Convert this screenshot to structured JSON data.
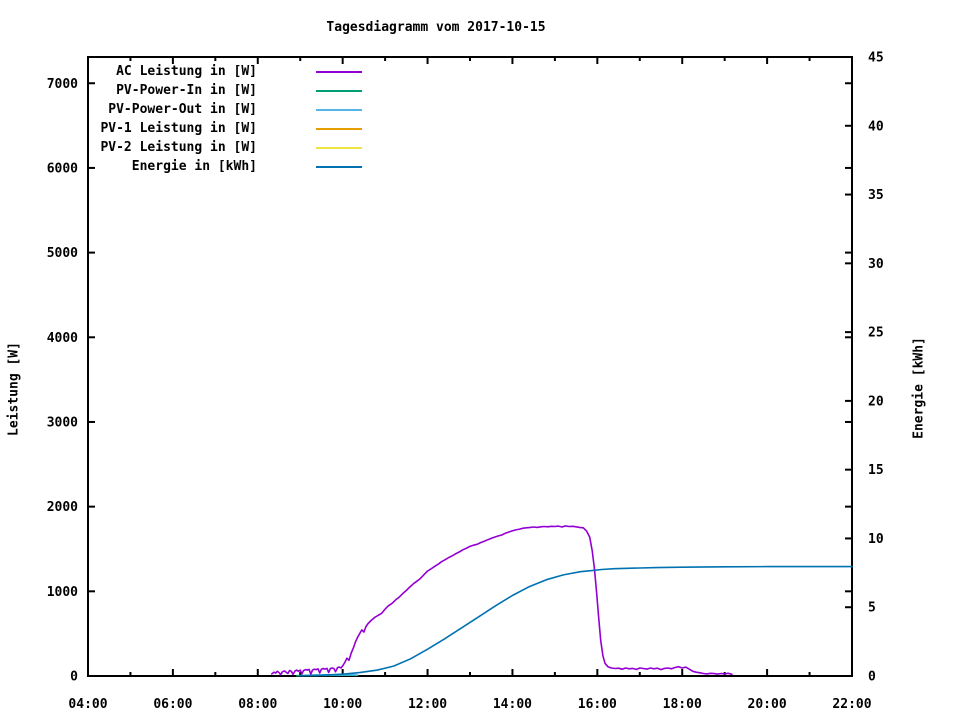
{
  "title": "Tagesdiagramm vom 2017-10-15",
  "axes": {
    "y1_label": "Leistung [W]",
    "y2_label": "Energie [kWh]",
    "y1_ticks": [
      0,
      1000,
      2000,
      3000,
      4000,
      5000,
      6000,
      7000
    ],
    "y2_ticks": [
      0,
      5,
      10,
      15,
      20,
      25,
      30,
      35,
      40,
      45
    ],
    "x_ticks": [
      {
        "h": 4,
        "label": "04:00"
      },
      {
        "h": 6,
        "label": "06:00"
      },
      {
        "h": 8,
        "label": "08:00"
      },
      {
        "h": 10,
        "label": "10:00"
      },
      {
        "h": 12,
        "label": "12:00"
      },
      {
        "h": 14,
        "label": "14:00"
      },
      {
        "h": 16,
        "label": "16:00"
      },
      {
        "h": 18,
        "label": "18:00"
      },
      {
        "h": 20,
        "label": "20:00"
      },
      {
        "h": 22,
        "label": "22:00"
      }
    ],
    "x_minor_ticks": [
      5,
      7,
      9,
      11,
      13,
      15,
      17,
      19,
      21
    ]
  },
  "chart_data": {
    "type": "line",
    "title": "Tagesdiagramm vom 2017-10-15",
    "xlabel": "",
    "ylabel": "Leistung [W]",
    "y2label": "Energie [kWh]",
    "x_unit": "hour-of-day",
    "xlim": [
      4,
      22
    ],
    "ylim": [
      0,
      7310
    ],
    "y2lim": [
      0,
      45
    ],
    "grid": false,
    "legend_position": "top-left-inside",
    "series": [
      {
        "name": "AC Leistung in [W]",
        "color": "#9400d3",
        "axis": "y1",
        "points": [
          [
            8.33,
            25
          ],
          [
            8.38,
            45
          ],
          [
            8.42,
            35
          ],
          [
            8.46,
            55
          ],
          [
            8.5,
            40
          ],
          [
            8.54,
            15
          ],
          [
            8.58,
            50
          ],
          [
            8.63,
            60
          ],
          [
            8.67,
            45
          ],
          [
            8.71,
            30
          ],
          [
            8.75,
            65
          ],
          [
            8.79,
            55
          ],
          [
            8.83,
            20
          ],
          [
            8.88,
            60
          ],
          [
            8.92,
            70
          ],
          [
            8.96,
            55
          ],
          [
            9.0,
            70
          ],
          [
            9.04,
            25
          ],
          [
            9.08,
            65
          ],
          [
            9.13,
            75
          ],
          [
            9.17,
            70
          ],
          [
            9.21,
            78
          ],
          [
            9.25,
            20
          ],
          [
            9.29,
            70
          ],
          [
            9.33,
            80
          ],
          [
            9.38,
            75
          ],
          [
            9.42,
            85
          ],
          [
            9.46,
            35
          ],
          [
            9.5,
            80
          ],
          [
            9.54,
            88
          ],
          [
            9.58,
            82
          ],
          [
            9.63,
            90
          ],
          [
            9.67,
            40
          ],
          [
            9.71,
            88
          ],
          [
            9.75,
            95
          ],
          [
            9.79,
            90
          ],
          [
            9.83,
            50
          ],
          [
            9.88,
            100
          ],
          [
            9.92,
            105
          ],
          [
            9.96,
            95
          ],
          [
            10.0,
            120
          ],
          [
            10.05,
            160
          ],
          [
            10.1,
            210
          ],
          [
            10.15,
            185
          ],
          [
            10.2,
            270
          ],
          [
            10.25,
            330
          ],
          [
            10.3,
            400
          ],
          [
            10.35,
            455
          ],
          [
            10.4,
            500
          ],
          [
            10.45,
            545
          ],
          [
            10.5,
            520
          ],
          [
            10.55,
            585
          ],
          [
            10.6,
            620
          ],
          [
            10.67,
            655
          ],
          [
            10.75,
            690
          ],
          [
            10.83,
            715
          ],
          [
            10.92,
            740
          ],
          [
            11.0,
            790
          ],
          [
            11.08,
            830
          ],
          [
            11.17,
            860
          ],
          [
            11.25,
            900
          ],
          [
            11.33,
            930
          ],
          [
            11.42,
            975
          ],
          [
            11.5,
            1010
          ],
          [
            11.58,
            1050
          ],
          [
            11.67,
            1090
          ],
          [
            11.75,
            1120
          ],
          [
            11.83,
            1150
          ],
          [
            11.92,
            1200
          ],
          [
            12.0,
            1240
          ],
          [
            12.08,
            1265
          ],
          [
            12.17,
            1295
          ],
          [
            12.25,
            1320
          ],
          [
            12.33,
            1350
          ],
          [
            12.42,
            1375
          ],
          [
            12.5,
            1400
          ],
          [
            12.58,
            1420
          ],
          [
            12.67,
            1445
          ],
          [
            12.75,
            1465
          ],
          [
            12.83,
            1490
          ],
          [
            12.92,
            1510
          ],
          [
            13.0,
            1530
          ],
          [
            13.08,
            1545
          ],
          [
            13.17,
            1555
          ],
          [
            13.25,
            1575
          ],
          [
            13.33,
            1590
          ],
          [
            13.42,
            1610
          ],
          [
            13.5,
            1625
          ],
          [
            13.58,
            1640
          ],
          [
            13.67,
            1655
          ],
          [
            13.75,
            1665
          ],
          [
            13.83,
            1685
          ],
          [
            13.92,
            1700
          ],
          [
            14.0,
            1715
          ],
          [
            14.08,
            1725
          ],
          [
            14.17,
            1735
          ],
          [
            14.25,
            1745
          ],
          [
            14.33,
            1750
          ],
          [
            14.42,
            1755
          ],
          [
            14.5,
            1760
          ],
          [
            14.58,
            1755
          ],
          [
            14.67,
            1762
          ],
          [
            14.75,
            1765
          ],
          [
            14.83,
            1762
          ],
          [
            14.92,
            1768
          ],
          [
            15.0,
            1765
          ],
          [
            15.08,
            1770
          ],
          [
            15.17,
            1760
          ],
          [
            15.25,
            1772
          ],
          [
            15.33,
            1765
          ],
          [
            15.42,
            1768
          ],
          [
            15.5,
            1762
          ],
          [
            15.58,
            1755
          ],
          [
            15.67,
            1750
          ],
          [
            15.75,
            1710
          ],
          [
            15.82,
            1640
          ],
          [
            15.88,
            1480
          ],
          [
            15.93,
            1270
          ],
          [
            15.98,
            1000
          ],
          [
            16.03,
            700
          ],
          [
            16.08,
            420
          ],
          [
            16.13,
            240
          ],
          [
            16.18,
            150
          ],
          [
            16.25,
            110
          ],
          [
            16.33,
            95
          ],
          [
            16.42,
            88
          ],
          [
            16.5,
            92
          ],
          [
            16.58,
            80
          ],
          [
            16.67,
            95
          ],
          [
            16.75,
            85
          ],
          [
            16.83,
            90
          ],
          [
            16.92,
            78
          ],
          [
            17.0,
            95
          ],
          [
            17.08,
            88
          ],
          [
            17.17,
            82
          ],
          [
            17.25,
            95
          ],
          [
            17.33,
            85
          ],
          [
            17.42,
            92
          ],
          [
            17.5,
            75
          ],
          [
            17.58,
            90
          ],
          [
            17.67,
            95
          ],
          [
            17.75,
            85
          ],
          [
            17.83,
            100
          ],
          [
            17.92,
            110
          ],
          [
            18.0,
            95
          ],
          [
            18.08,
            105
          ],
          [
            18.17,
            80
          ],
          [
            18.25,
            55
          ],
          [
            18.33,
            45
          ],
          [
            18.42,
            38
          ],
          [
            18.5,
            30
          ],
          [
            18.58,
            25
          ],
          [
            18.67,
            32
          ],
          [
            18.75,
            28
          ],
          [
            18.83,
            22
          ],
          [
            18.92,
            30
          ],
          [
            19.0,
            25
          ],
          [
            19.08,
            32
          ],
          [
            19.17,
            20
          ]
        ]
      },
      {
        "name": "PV-Power-In in [W]",
        "color": "#009e73",
        "axis": "y1",
        "points": [
          [
            8.92,
            3
          ],
          [
            9.2,
            5
          ],
          [
            9.5,
            6
          ],
          [
            9.8,
            8
          ],
          [
            10.1,
            10
          ],
          [
            10.35,
            8
          ]
        ]
      },
      {
        "name": "PV-Power-Out in [W]",
        "color": "#56b4e9",
        "axis": "y1",
        "points": [
          [
            9.3,
            12
          ],
          [
            9.6,
            14
          ],
          [
            9.9,
            12
          ],
          [
            10.2,
            15
          ],
          [
            10.35,
            12
          ]
        ]
      },
      {
        "name": "PV-1 Leistung in [W]",
        "color": "#e69f00",
        "axis": "y1",
        "points": []
      },
      {
        "name": "PV-2 Leistung in [W]",
        "color": "#f0e442",
        "axis": "y1",
        "points": []
      },
      {
        "name": "Energie in [kWh]",
        "color": "#0072b2",
        "axis": "y2",
        "points": [
          [
            9.0,
            0.02
          ],
          [
            9.5,
            0.06
          ],
          [
            10.0,
            0.13
          ],
          [
            10.4,
            0.25
          ],
          [
            10.8,
            0.42
          ],
          [
            11.2,
            0.72
          ],
          [
            11.6,
            1.25
          ],
          [
            12.0,
            1.95
          ],
          [
            12.4,
            2.7
          ],
          [
            12.8,
            3.5
          ],
          [
            13.2,
            4.3
          ],
          [
            13.6,
            5.1
          ],
          [
            14.0,
            5.85
          ],
          [
            14.4,
            6.5
          ],
          [
            14.8,
            7.0
          ],
          [
            15.2,
            7.35
          ],
          [
            15.6,
            7.58
          ],
          [
            15.9,
            7.68
          ],
          [
            16.1,
            7.74
          ],
          [
            16.4,
            7.8
          ],
          [
            16.8,
            7.84
          ],
          [
            17.4,
            7.88
          ],
          [
            18.0,
            7.91
          ],
          [
            19.0,
            7.94
          ],
          [
            20.0,
            7.95
          ],
          [
            21.0,
            7.95
          ],
          [
            22.0,
            7.95
          ]
        ]
      }
    ]
  },
  "colors": {
    "foreground": "#000000",
    "background": "#ffffff"
  }
}
